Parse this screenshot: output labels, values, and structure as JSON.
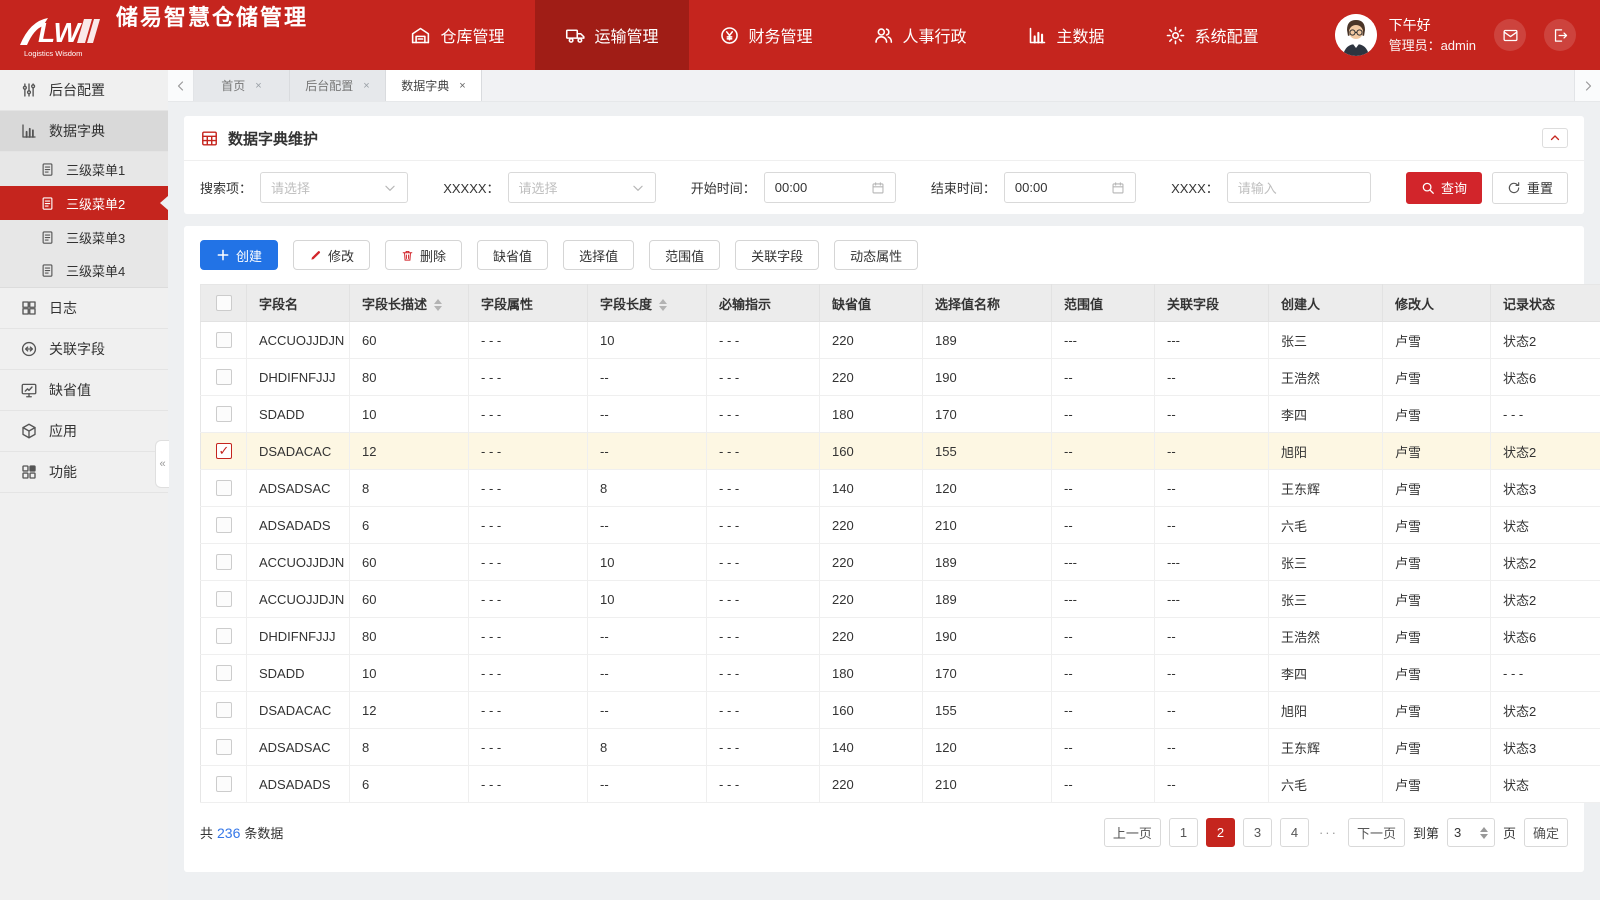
{
  "header": {
    "logo_mark": "LW",
    "logo_subtitle": "Logistics Wisdom",
    "app_title": "储易智慧仓储管理",
    "nav": [
      {
        "label": "仓库管理",
        "icon": "warehouse-icon",
        "active": false
      },
      {
        "label": "运输管理",
        "icon": "truck-icon",
        "active": true
      },
      {
        "label": "财务管理",
        "icon": "finance-icon",
        "active": false
      },
      {
        "label": "人事行政",
        "icon": "people-icon",
        "active": false
      },
      {
        "label": "主数据",
        "icon": "bar-chart-icon",
        "active": false
      },
      {
        "label": "系统配置",
        "icon": "gear-icon",
        "active": false
      }
    ],
    "user": {
      "greeting": "下午好",
      "role": "管理员：admin"
    }
  },
  "sidebar": {
    "items": [
      {
        "label": "后台配置",
        "icon": "sliders-icon",
        "level": 1,
        "state": "normal"
      },
      {
        "label": "数据字典",
        "icon": "chart-icon",
        "level": 1,
        "state": "open"
      },
      {
        "label": "三级菜单1",
        "icon": "doc-icon",
        "level": 2,
        "state": "normal"
      },
      {
        "label": "三级菜单2",
        "icon": "doc-icon",
        "level": 2,
        "state": "active"
      },
      {
        "label": "三级菜单3",
        "icon": "doc-icon",
        "level": 2,
        "state": "normal"
      },
      {
        "label": "三级菜单4",
        "icon": "doc-icon",
        "level": 2,
        "state": "normal"
      },
      {
        "label": "日志",
        "icon": "grid-icon",
        "level": 1,
        "state": "normal"
      },
      {
        "label": "关联字段",
        "icon": "link-icon",
        "level": 1,
        "state": "normal"
      },
      {
        "label": "缺省值",
        "icon": "monitor-icon",
        "level": 1,
        "state": "normal"
      },
      {
        "label": "应用",
        "icon": "box-icon",
        "level": 1,
        "state": "normal"
      },
      {
        "label": "功能",
        "icon": "apps-icon",
        "level": 1,
        "state": "normal"
      }
    ],
    "collapse_glyph": "«"
  },
  "tabs": [
    {
      "label": "首页",
      "active": false
    },
    {
      "label": "后台配置",
      "active": false
    },
    {
      "label": "数据字典",
      "active": true
    }
  ],
  "filter_panel": {
    "title": "数据字典维护",
    "fields": [
      {
        "label": "搜索项：",
        "control": "select",
        "value": "请选择"
      },
      {
        "label": "XXXXX：",
        "control": "select",
        "value": "请选择"
      },
      {
        "label": "开始时间：",
        "control": "time",
        "value": "00:00"
      },
      {
        "label": "结束时间：",
        "control": "time",
        "value": "00:00"
      },
      {
        "label": "XXXX：",
        "control": "input",
        "placeholder": "请输入"
      }
    ],
    "search_button": "查询",
    "reset_button": "重置"
  },
  "toolbar": {
    "buttons": [
      {
        "label": "创建",
        "icon": "plus-icon",
        "style": "primary"
      },
      {
        "label": "修改",
        "icon": "pencil-icon",
        "style": "default"
      },
      {
        "label": "删除",
        "icon": "trash-icon",
        "style": "default"
      },
      {
        "label": "缺省值",
        "style": "default"
      },
      {
        "label": "选择值",
        "style": "default"
      },
      {
        "label": "范围值",
        "style": "default"
      },
      {
        "label": "关联字段",
        "style": "default"
      },
      {
        "label": "动态属性",
        "style": "default"
      }
    ]
  },
  "table": {
    "columns": [
      {
        "label": "字段名",
        "sortable": false
      },
      {
        "label": "字段长描述",
        "sortable": true
      },
      {
        "label": "字段属性",
        "sortable": false
      },
      {
        "label": "字段长度",
        "sortable": true
      },
      {
        "label": "必输指示",
        "sortable": false
      },
      {
        "label": "缺省值",
        "sortable": false
      },
      {
        "label": "选择值名称",
        "sortable": false
      },
      {
        "label": "范围值",
        "sortable": false
      },
      {
        "label": "关联字段",
        "sortable": false
      },
      {
        "label": "创建人",
        "sortable": false
      },
      {
        "label": "修改人",
        "sortable": false
      },
      {
        "label": "记录状态",
        "sortable": false
      }
    ],
    "rows": [
      {
        "checked": false,
        "highlighted": false,
        "cells": [
          "ACCUOJJDJN",
          "60",
          "- - -",
          "10",
          "- - -",
          "220",
          "189",
          "---",
          "---",
          "张三",
          "卢雪",
          "状态2"
        ]
      },
      {
        "checked": false,
        "highlighted": false,
        "cells": [
          "DHDIFNFJJJ",
          "80",
          "- - -",
          "--",
          "- - -",
          "220",
          "190",
          "--",
          "--",
          "王浩然",
          "卢雪",
          "状态6"
        ]
      },
      {
        "checked": false,
        "highlighted": false,
        "cells": [
          "SDADD",
          "10",
          "- - -",
          "--",
          "- - -",
          "180",
          "170",
          "--",
          "--",
          "李四",
          "卢雪",
          "- - -"
        ]
      },
      {
        "checked": true,
        "highlighted": true,
        "cells": [
          "DSADACAC",
          "12",
          "- - -",
          "--",
          "- - -",
          "160",
          "155",
          "--",
          "--",
          "旭阳",
          "卢雪",
          "状态2"
        ]
      },
      {
        "checked": false,
        "highlighted": false,
        "cells": [
          "ADSADSAC",
          "8",
          "- - -",
          "8",
          "- - -",
          "140",
          "120",
          "--",
          "--",
          "王东辉",
          "卢雪",
          "状态3"
        ]
      },
      {
        "checked": false,
        "highlighted": false,
        "cells": [
          "ADSADADS",
          "6",
          "- - -",
          "--",
          "- - -",
          "220",
          "210",
          "--",
          "--",
          "六毛",
          "卢雪",
          "状态"
        ]
      },
      {
        "checked": false,
        "highlighted": false,
        "cells": [
          "ACCUOJJDJN",
          "60",
          "- - -",
          "10",
          "- - -",
          "220",
          "189",
          "---",
          "---",
          "张三",
          "卢雪",
          "状态2"
        ]
      },
      {
        "checked": false,
        "highlighted": false,
        "cells": [
          "ACCUOJJDJN",
          "60",
          "- - -",
          "10",
          "- - -",
          "220",
          "189",
          "---",
          "---",
          "张三",
          "卢雪",
          "状态2"
        ]
      },
      {
        "checked": false,
        "highlighted": false,
        "cells": [
          "DHDIFNFJJJ",
          "80",
          "- - -",
          "--",
          "- - -",
          "220",
          "190",
          "--",
          "--",
          "王浩然",
          "卢雪",
          "状态6"
        ]
      },
      {
        "checked": false,
        "highlighted": false,
        "cells": [
          "SDADD",
          "10",
          "- - -",
          "--",
          "- - -",
          "180",
          "170",
          "--",
          "--",
          "李四",
          "卢雪",
          "- - -"
        ]
      },
      {
        "checked": false,
        "highlighted": false,
        "cells": [
          "DSADACAC",
          "12",
          "- - -",
          "--",
          "- - -",
          "160",
          "155",
          "--",
          "--",
          "旭阳",
          "卢雪",
          "状态2"
        ]
      },
      {
        "checked": false,
        "highlighted": false,
        "cells": [
          "ADSADSAC",
          "8",
          "- - -",
          "8",
          "- - -",
          "140",
          "120",
          "--",
          "--",
          "王东辉",
          "卢雪",
          "状态3"
        ]
      },
      {
        "checked": false,
        "highlighted": false,
        "cells": [
          "ADSADADS",
          "6",
          "- - -",
          "--",
          "- - -",
          "220",
          "210",
          "--",
          "--",
          "六毛",
          "卢雪",
          "状态"
        ]
      }
    ]
  },
  "pagination": {
    "total_prefix": "共",
    "total_count": "236",
    "total_suffix": "条数据",
    "prev_label": "上一页",
    "pages": [
      "1",
      "2",
      "3",
      "4"
    ],
    "active_page": "2",
    "ellipsis": "···",
    "next_label": "下一页",
    "goto_prefix": "到第",
    "goto_page": "3",
    "goto_suffix": "页",
    "confirm_label": "确定"
  },
  "colors": {
    "header_red": "#c5251e",
    "header_active_red": "#a01d16",
    "primary_blue": "#2273e6",
    "query_red": "#d2252b",
    "highlight_row": "#fdf7e3",
    "count_blue": "#3577e8"
  }
}
